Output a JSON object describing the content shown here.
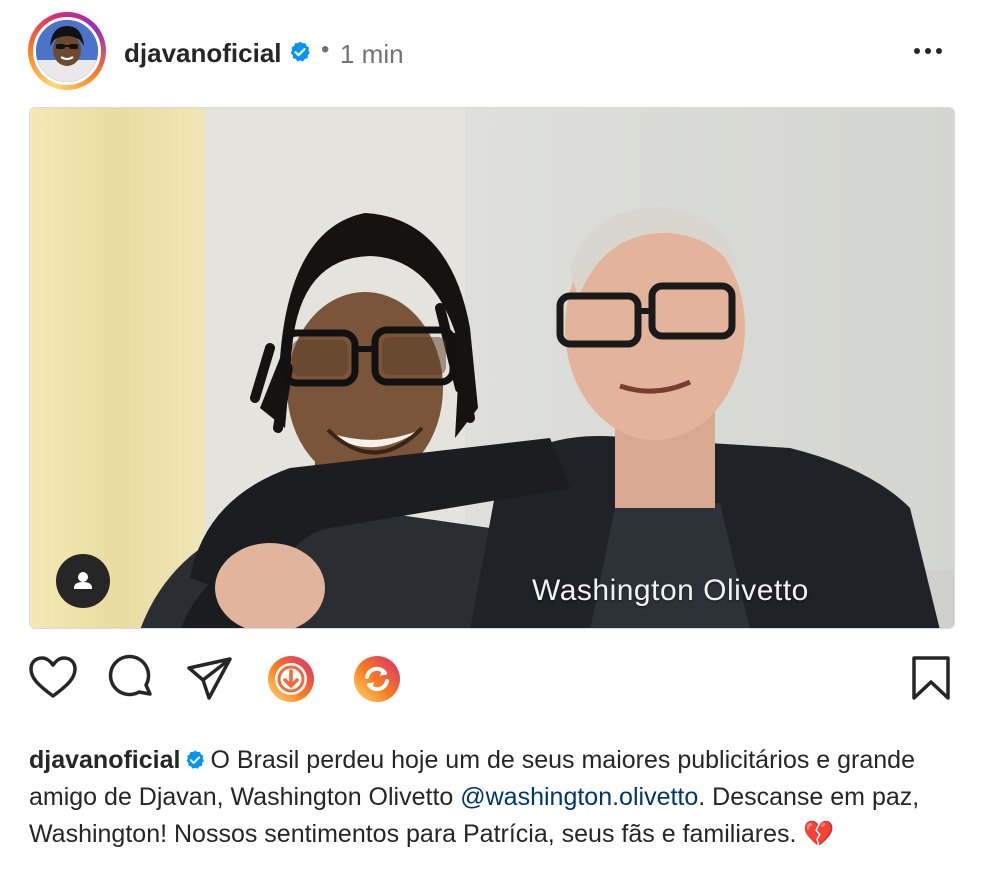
{
  "post": {
    "username": "djavanoficial",
    "separator": "•",
    "time": "1 min",
    "photo_caption": "Washington Olivetto"
  },
  "caption": {
    "username": "djavanoficial",
    "text_1": "O Brasil perdeu hoje um de seus maiores publicitários e grande amigo de Djavan, Washington Olivetto",
    "mention": "@washington.olivetto",
    "text_2": ". Descanse em paz, Washington! Nossos sentimentos para Patrícia, seus fãs e familiares.",
    "emoji": "💔"
  },
  "icons": {
    "more": "more-horizontal-icon",
    "verified": "verified-badge-icon",
    "tag": "user-tag-icon",
    "like": "heart-icon",
    "comment": "comment-icon",
    "share": "send-icon",
    "download": "download-icon",
    "repost": "repost-icon",
    "save": "bookmark-icon"
  },
  "colors": {
    "verified": "#0095f6",
    "mention": "#00376b",
    "muted": "#737373",
    "broken_heart": "#e8417a"
  }
}
